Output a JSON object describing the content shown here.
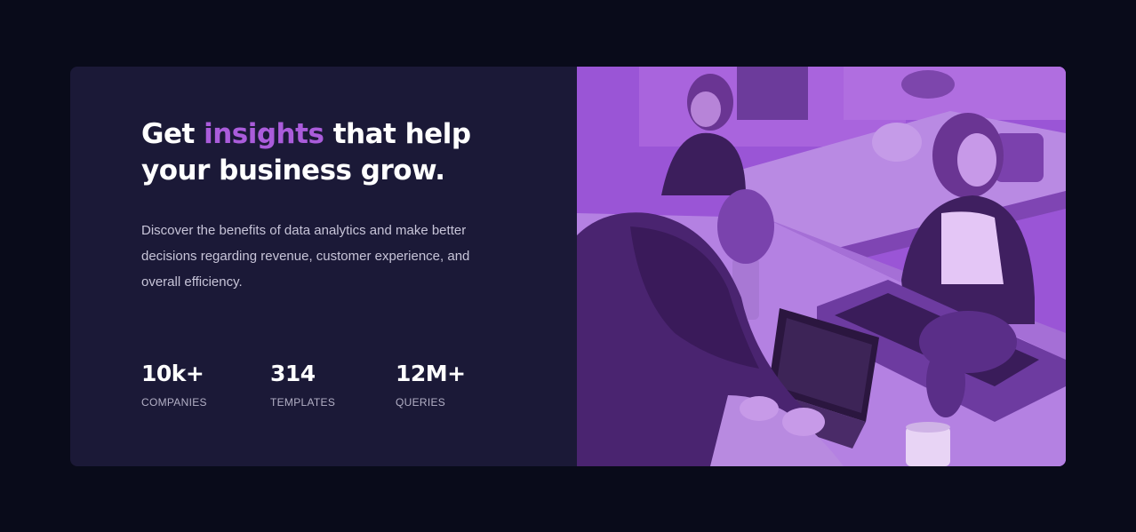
{
  "hero": {
    "heading_pre": "Get ",
    "heading_accent": "insights",
    "heading_post": " that help your business grow.",
    "description": "Discover the benefits of data analytics and make better decisions regarding revenue, customer experience, and overall efficiency."
  },
  "stats": [
    {
      "value": "10k+",
      "label": "COMPANIES"
    },
    {
      "value": "314",
      "label": "TEMPLATES"
    },
    {
      "value": "12M+",
      "label": "QUERIES"
    }
  ],
  "colors": {
    "page_background": "#090b1a",
    "card_background": "#1b1937",
    "accent": "#aa5cdb",
    "photo_overlay": "#9b55d8"
  },
  "image": {
    "icon": "office-photo-image"
  }
}
